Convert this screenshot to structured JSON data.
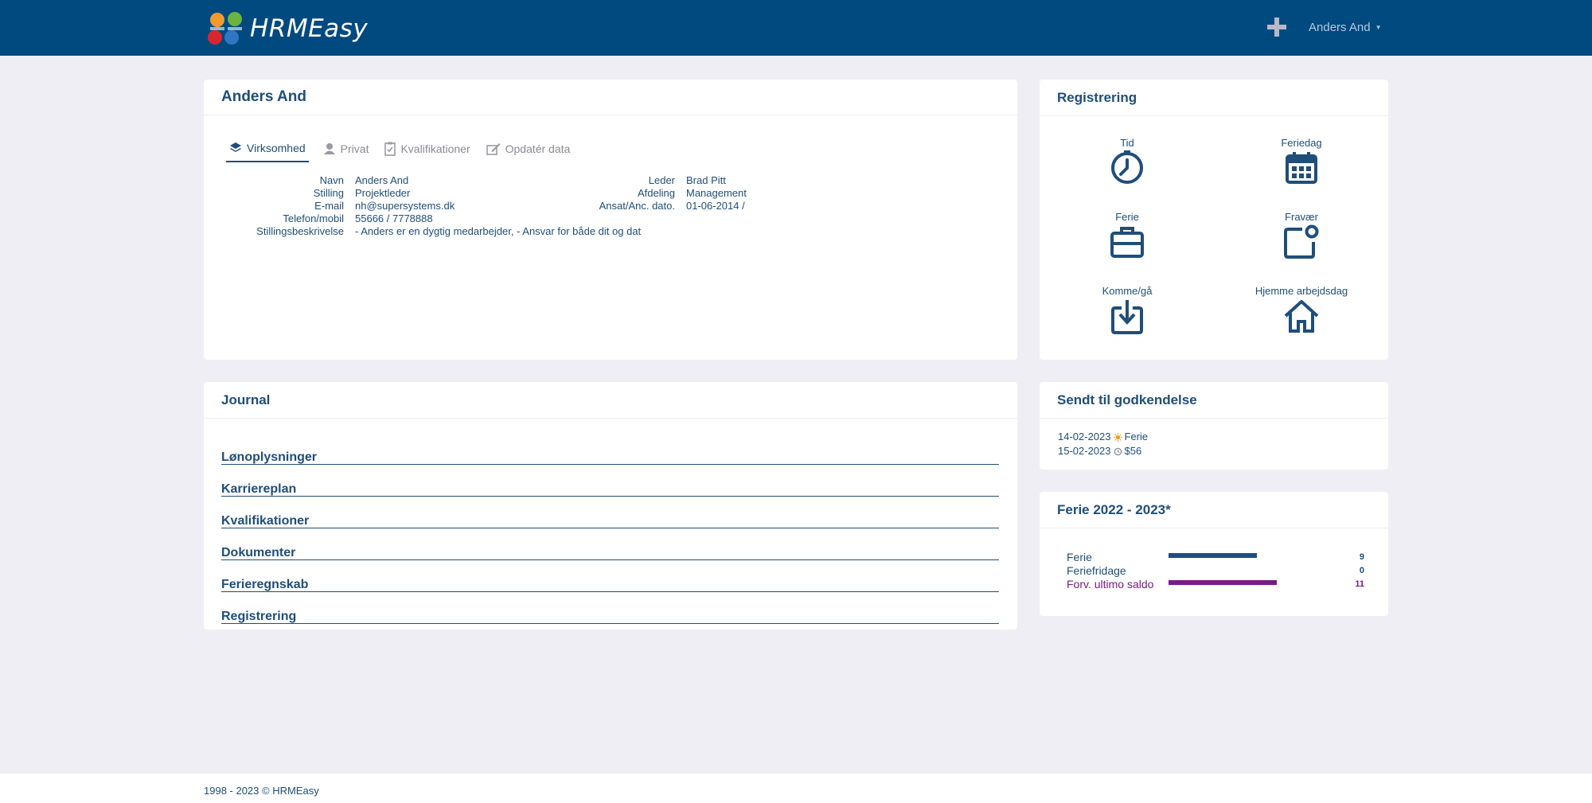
{
  "app": {
    "name": "HRMEasy",
    "user": "Anders And"
  },
  "profile": {
    "title": "Anders And",
    "tabs": [
      {
        "label": "Virksomhed",
        "icon": "layers-icon",
        "active": true
      },
      {
        "label": "Privat",
        "icon": "person-icon"
      },
      {
        "label": "Kvalifikationer",
        "icon": "clipboard-icon"
      },
      {
        "label": "Opdatér data",
        "icon": "edit-icon"
      }
    ],
    "left": [
      {
        "k": "Navn",
        "v": "Anders And"
      },
      {
        "k": "Stilling",
        "v": "Projektleder"
      },
      {
        "k": "E-mail",
        "v": "nh@supersystems.dk"
      },
      {
        "k": "Telefon/mobil",
        "v": "55666 / 7778888"
      },
      {
        "k": "Stillingsbeskrivelse",
        "v": "- Anders er en dygtig medarbejder, - Ansvar for både dit og dat"
      }
    ],
    "right": [
      {
        "k": "Leder",
        "v": "Brad Pitt"
      },
      {
        "k": "Afdeling",
        "v": "Management"
      },
      {
        "k": "Ansat/Anc. dato.",
        "v": "01-06-2014 /"
      }
    ]
  },
  "registrering": {
    "title": "Registrering",
    "items": [
      {
        "label": "Tid",
        "icon": "clock-icon"
      },
      {
        "label": "Feriedag",
        "icon": "calendar-icon"
      },
      {
        "label": "Ferie",
        "icon": "briefcase-icon"
      },
      {
        "label": "Fravær",
        "icon": "absence-icon"
      },
      {
        "label": "Komme/gå",
        "icon": "checkin-icon"
      },
      {
        "label": "Hjemme arbejdsdag",
        "icon": "home-icon"
      }
    ]
  },
  "journal": {
    "title": "Journal",
    "items": [
      "Lønoplysninger",
      "Karriereplan",
      "Kvalifikationer",
      "Dokumenter",
      "Ferieregnskab",
      "Registrering"
    ]
  },
  "sent": {
    "title": "Sendt til godkendelse",
    "items": [
      {
        "date": "14-02-2023",
        "icon": "sun-icon",
        "text": "Ferie"
      },
      {
        "date": "15-02-2023",
        "icon": "clock-small-icon",
        "text": "$56"
      }
    ]
  },
  "ferie": {
    "title": "Ferie 2022 - 2023*",
    "max": 11,
    "rows": [
      {
        "label": "Ferie",
        "value": 9,
        "display": "9",
        "color": "#1f4e79"
      },
      {
        "label": "Feriefridage",
        "value": 0,
        "display": "0",
        "color": "#1f4e79"
      },
      {
        "label": "Forv. ultimo saldo",
        "value": 11,
        "display": "11",
        "color": "#7a1a8c"
      }
    ]
  },
  "footer": {
    "text": "1998 - 2023 © HRMEasy"
  },
  "colors": {
    "brand": "#004a80",
    "text": "#1f4e79",
    "accent_purple": "#7a1a8c"
  }
}
